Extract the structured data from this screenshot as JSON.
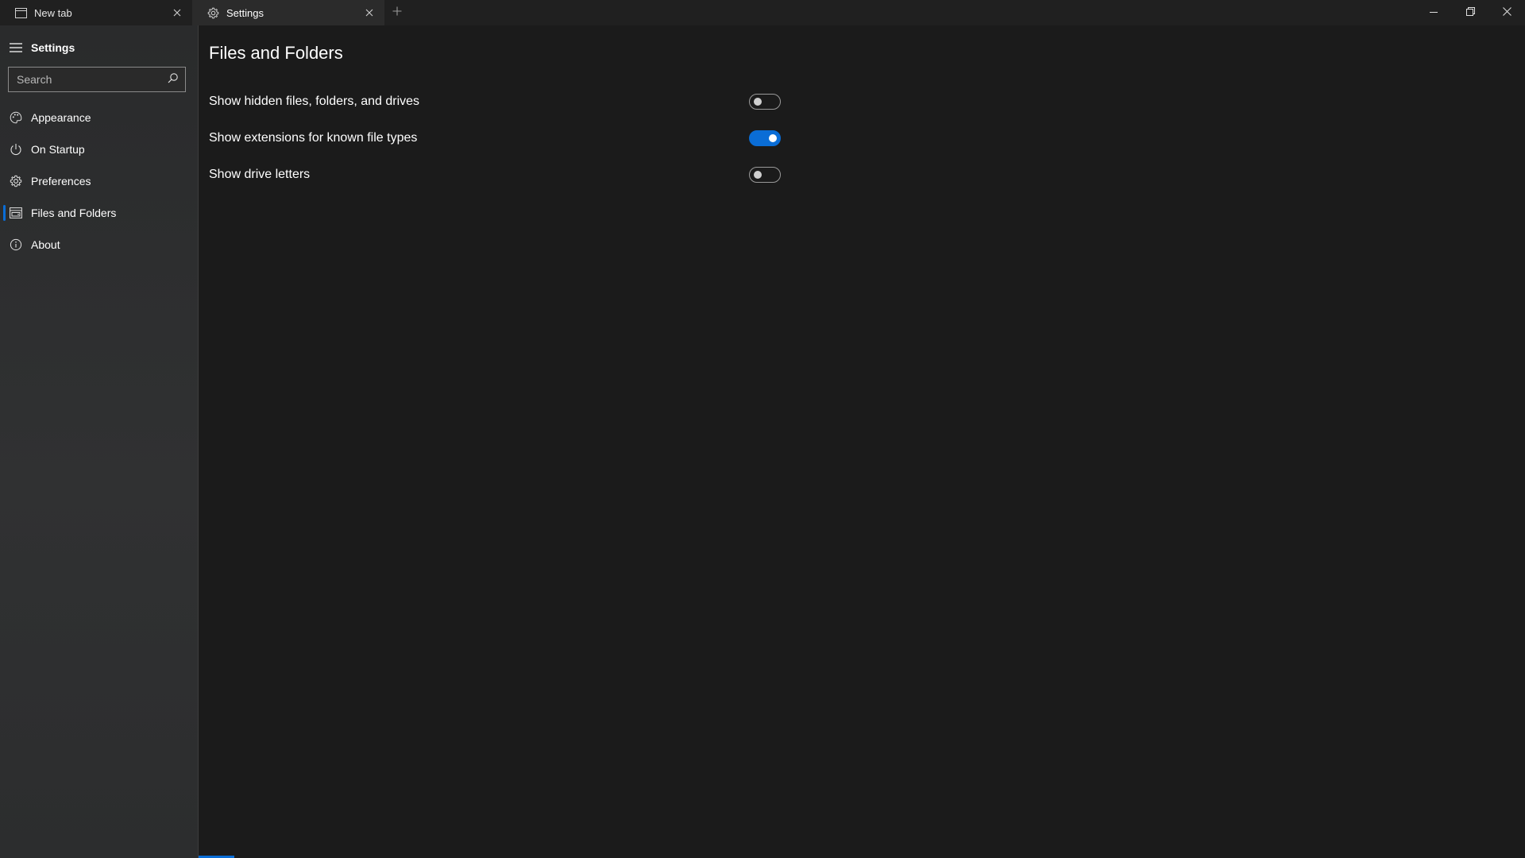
{
  "tabs": [
    {
      "label": "New tab",
      "icon": "window-icon",
      "active": false
    },
    {
      "label": "Settings",
      "icon": "gear-icon",
      "active": true
    }
  ],
  "sidebar": {
    "title": "Settings",
    "search": {
      "placeholder": "Search",
      "value": ""
    },
    "items": [
      {
        "label": "Appearance",
        "icon": "palette-icon"
      },
      {
        "label": "On Startup",
        "icon": "power-icon"
      },
      {
        "label": "Preferences",
        "icon": "gear-icon"
      },
      {
        "label": "Files and Folders",
        "icon": "drive-icon",
        "selected": true
      },
      {
        "label": "About",
        "icon": "info-icon"
      }
    ]
  },
  "main": {
    "title": "Files and Folders",
    "settings": [
      {
        "label": "Show hidden files, folders, and drives",
        "on": false
      },
      {
        "label": "Show extensions for known file types",
        "on": true
      },
      {
        "label": "Show drive letters",
        "on": false
      }
    ]
  },
  "colors": {
    "accent": "#0a6dd6",
    "background": "#1b1b1b",
    "sidebar": "#2d2e2f",
    "titlebar": "#202020"
  }
}
